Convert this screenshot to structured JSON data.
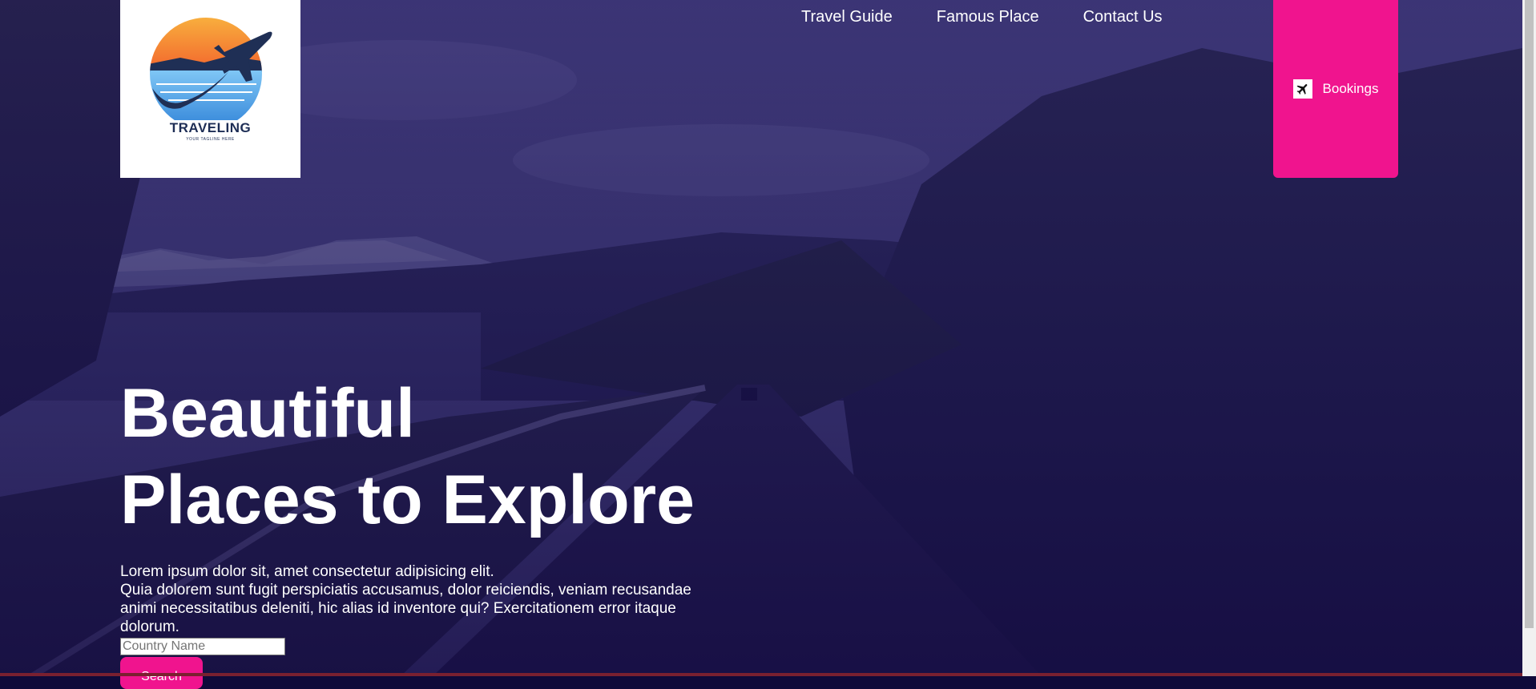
{
  "logo": {
    "name": "TRAVELING",
    "tagline": "YOUR TAGLINE HERE"
  },
  "nav": {
    "items": [
      {
        "label": "Travel Guide"
      },
      {
        "label": "Famous Place"
      },
      {
        "label": "Contact Us"
      }
    ]
  },
  "bookings": {
    "label": "Bookings",
    "icon": "airplane-icon"
  },
  "hero": {
    "headline_line1": "Beautiful",
    "headline_line2": "Places to Explore",
    "description_line1": "Lorem ipsum dolor sit, amet consectetur adipisicing elit.",
    "description_line2": "Quia dolorem sunt fugit perspiciatis accusamus, dolor reiciendis, veniam recusandae animi necessitatibus deleniti, hic alias id inventore qui? Exercitationem error itaque dolorum."
  },
  "search": {
    "placeholder": "Country Name",
    "value": "",
    "button_label": "Search"
  },
  "colors": {
    "accent": "#f0148e",
    "overlay": "#1a0f5c",
    "logo_text": "#1d2d55"
  }
}
